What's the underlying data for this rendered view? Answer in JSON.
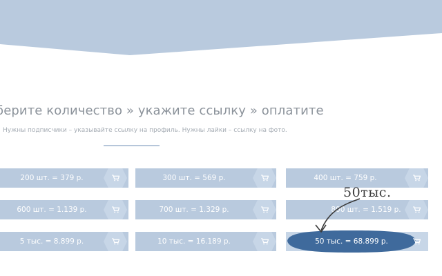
{
  "heading": "берите количество » укажите ссылку » оплатите",
  "subheading": "Нужны подписчики – указывайте ссылку на профиль. Нужны лайки – ссылку на фото.",
  "options": [
    {
      "label": "200 шт. = 379 р."
    },
    {
      "label": "300 шт. = 569 р."
    },
    {
      "label": "400 шт. = 759 р."
    },
    {
      "label": "600 шт. = 1.139 р."
    },
    {
      "label": "700 шт. = 1.329 р."
    },
    {
      "label": "800 шт. = 1.519 р."
    },
    {
      "label": "5 тыс. = 8.899 р."
    },
    {
      "label": "10 тыс. = 16.189 р."
    },
    {
      "label": "50 тыс. = 68.899 р.",
      "selected": true
    }
  ],
  "annotation": "50тыс.",
  "icons": {
    "cart": "shopping-cart-icon",
    "arrow": "curved-arrow-icon"
  },
  "colors": {
    "banner": "#b9cade",
    "card": "#b9cade",
    "cart_tab": "#c7d6e7",
    "selected": "#3f6a9c",
    "text": "#ffffff"
  }
}
